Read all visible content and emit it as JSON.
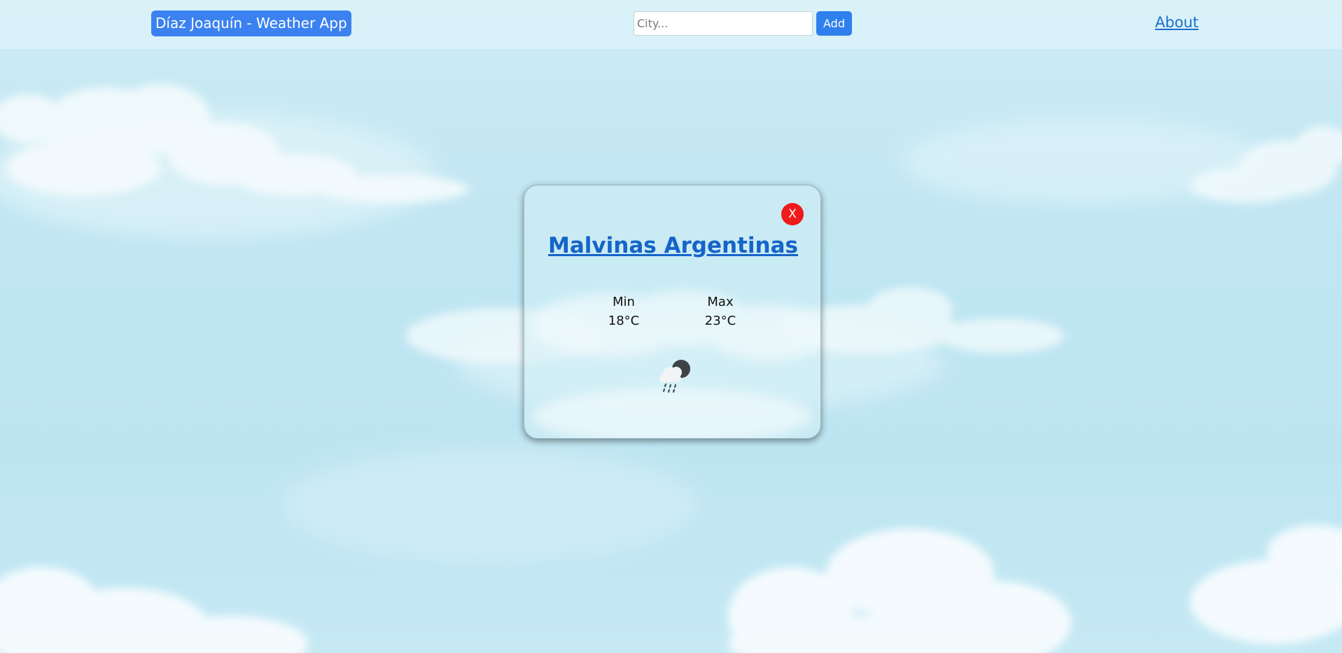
{
  "header": {
    "brand_label": "Díaz Joaquín - Weather App",
    "search_placeholder": "City...",
    "search_value": "",
    "add_label": "Add",
    "about_label": "About"
  },
  "card": {
    "close_label": "X",
    "city": "Malvinas Argentinas",
    "min_label": "Min",
    "min_value": "18°C",
    "max_label": "Max",
    "max_value": "23°C",
    "weather_icon": "cloud-rain-moon-icon"
  },
  "colors": {
    "brand_bg": "#3b82f0",
    "add_bg": "#2f80ed",
    "link": "#1a6fcf",
    "close_bg": "#f01b1b",
    "city_title": "#1564c8"
  }
}
